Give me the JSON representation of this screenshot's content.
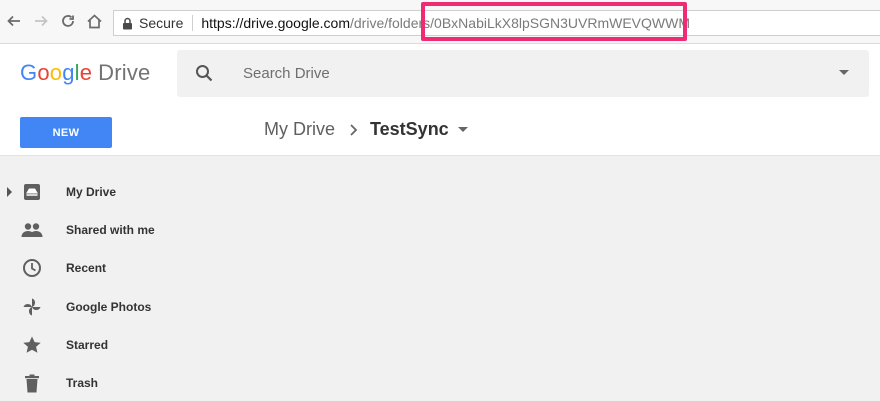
{
  "browser": {
    "secure_label": "Secure",
    "url_host": "https://drive.google.com",
    "url_path": "/drive/folders",
    "url_folder_id": "/0BxNabiLkX8lpSGN3UVRmWEVQWWM",
    "highlight_color": "#ee2b73"
  },
  "app": {
    "logo_letters": [
      "G",
      "o",
      "o",
      "g",
      "l",
      "e"
    ],
    "logo_product": "Drive"
  },
  "search": {
    "placeholder": "Search Drive"
  },
  "toolbar": {
    "new_label": "NEW",
    "new_color": "#4285f4"
  },
  "breadcrumb": {
    "root": "My Drive",
    "current": "TestSync"
  },
  "sidebar": {
    "items": [
      {
        "label": "My Drive",
        "icon": "drive-icon"
      },
      {
        "label": "Shared with me",
        "icon": "people-icon"
      },
      {
        "label": "Recent",
        "icon": "clock-icon"
      },
      {
        "label": "Google Photos",
        "icon": "pinwheel-icon"
      },
      {
        "label": "Starred",
        "icon": "star-icon"
      },
      {
        "label": "Trash",
        "icon": "trash-icon"
      }
    ]
  }
}
